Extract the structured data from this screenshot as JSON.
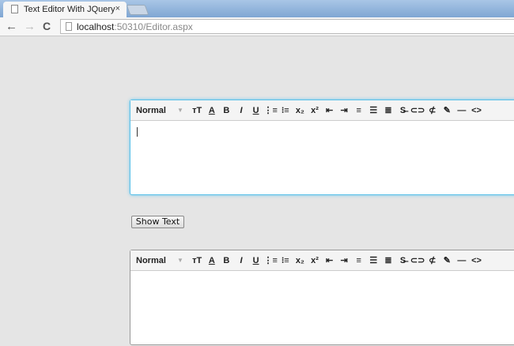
{
  "browser": {
    "tab_title": "Text Editor With JQuery",
    "close": "×",
    "url_host": "localhost",
    "url_rest": ":50310/Editor.aspx",
    "back": "←",
    "forward": "→",
    "reload": "C"
  },
  "toolbar": {
    "format": "Normal",
    "buttons": [
      {
        "name": "font-size",
        "g": "тT"
      },
      {
        "name": "font-color",
        "g": "A"
      },
      {
        "name": "bold",
        "g": "B"
      },
      {
        "name": "italic",
        "g": "I"
      },
      {
        "name": "underline",
        "g": "U"
      },
      {
        "name": "ordered-list",
        "g": "⋮≡"
      },
      {
        "name": "unordered-list",
        "g": "⁝≡"
      },
      {
        "name": "subscript",
        "g": "x₂"
      },
      {
        "name": "superscript",
        "g": "x²"
      },
      {
        "name": "outdent",
        "g": "⇤"
      },
      {
        "name": "indent",
        "g": "⇥"
      },
      {
        "name": "align-left",
        "g": "≡"
      },
      {
        "name": "align-center",
        "g": "☰"
      },
      {
        "name": "align-right",
        "g": "≣"
      },
      {
        "name": "strikethrough",
        "g": "S̶"
      },
      {
        "name": "link",
        "g": "⊂⊃"
      },
      {
        "name": "unlink",
        "g": "⊄"
      },
      {
        "name": "clear-format",
        "g": "✎"
      },
      {
        "name": "horizontal-rule",
        "g": "—"
      },
      {
        "name": "source",
        "g": "<>"
      }
    ]
  },
  "show_button": "Show Text"
}
